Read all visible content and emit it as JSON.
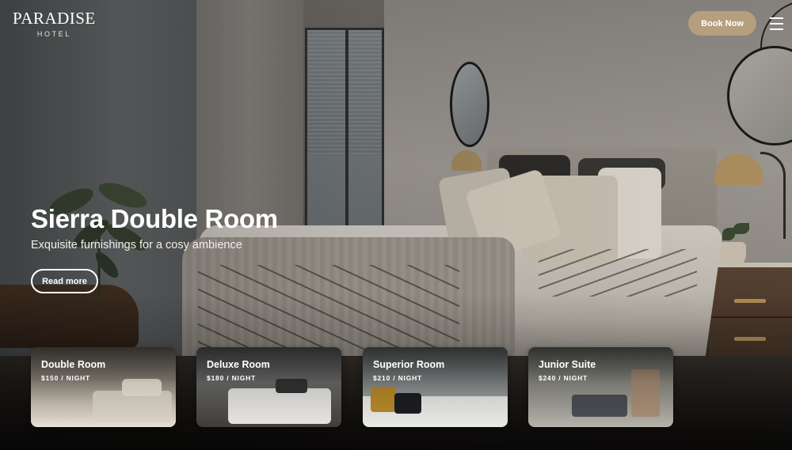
{
  "brand": {
    "name": "PARADISE",
    "subtitle": "HOTEL"
  },
  "header": {
    "book_label": "Book Now",
    "menu_icon": "hamburger-menu-icon"
  },
  "hero": {
    "title": "Sierra Double Room",
    "subtitle": "Exquisite furnishings for a cosy ambience",
    "cta_label": "Read more"
  },
  "rooms": [
    {
      "name": "Double Room",
      "price": "$150 / NIGHT"
    },
    {
      "name": "Deluxe Room",
      "price": "$180 / NIGHT"
    },
    {
      "name": "Superior Room",
      "price": "$210 / NIGHT"
    },
    {
      "name": "Junior Suite",
      "price": "$240 / NIGHT"
    }
  ],
  "colors": {
    "accent": "#b59f7c",
    "text": "#ffffff"
  }
}
